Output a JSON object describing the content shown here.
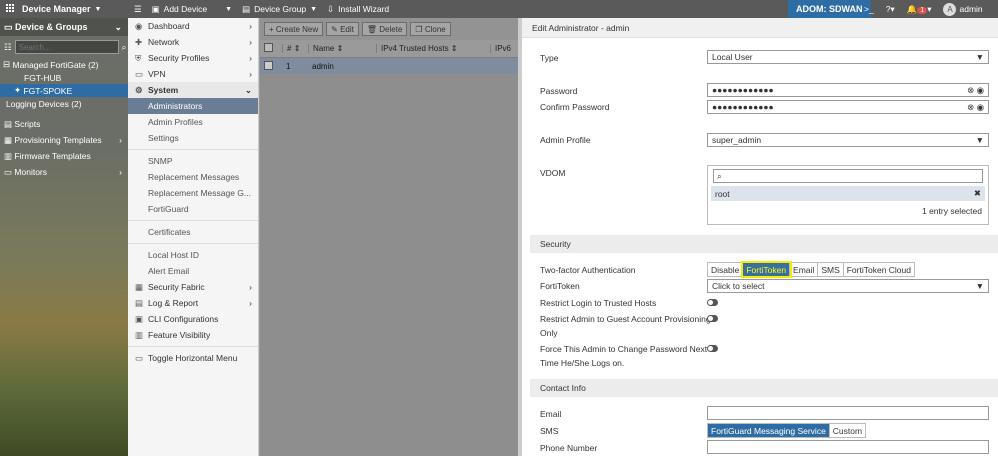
{
  "topbar": {
    "app": "Device Manager",
    "add_device": "Add Device",
    "device_group": "Device Group",
    "install_wizard": "Install Wizard",
    "adom": "ADOM: SDWAN",
    "notif_count": "1",
    "avatar": "A",
    "user": "admin"
  },
  "left": {
    "header": "Device & Groups",
    "search_placeholder": "Search...",
    "managed": "Managed FortiGate (2)",
    "hub": "FGT-HUB",
    "spoke": "FGT-SPOKE",
    "logging": "Logging Devices (2)",
    "nav": [
      "Scripts",
      "Provisioning Templates",
      "Firmware Templates",
      "Monitors"
    ]
  },
  "menu": {
    "items": [
      {
        "label": "Dashboard"
      },
      {
        "label": "Network"
      },
      {
        "label": "Security Profiles"
      },
      {
        "label": "VPN"
      }
    ],
    "system": "System",
    "sub": [
      "Administrators",
      "Admin Profiles",
      "Settings"
    ],
    "sub2": [
      "SNMP",
      "Replacement Messages",
      "Replacement Message G...",
      "FortiGuard"
    ],
    "sub3": [
      "Certificates"
    ],
    "sub4": [
      "Local Host ID",
      "Alert Email",
      "Security Fabric",
      "Log & Report",
      "CLI Configurations",
      "Feature Visibility"
    ],
    "sub5": [
      "Toggle Horizontal Menu"
    ]
  },
  "table": {
    "create_new": "Create New",
    "edit": "Edit",
    "delete": "Delete",
    "clone": "Clone",
    "col_num": "#",
    "col_name": "Name",
    "col_trusted": "IPv4 Trusted Hosts",
    "col_ipv6": "IPv6",
    "row_num": "1",
    "row_name": "admin"
  },
  "dialog": {
    "title": "Edit Administrator - admin",
    "type_label": "Type",
    "type_value": "Local User",
    "password_label": "Password",
    "password_value": "●●●●●●●●●●●●",
    "confirm_label": "Confirm Password",
    "confirm_value": "●●●●●●●●●●●●",
    "profile_label": "Admin Profile",
    "profile_value": "super_admin",
    "vdom_label": "VDOM",
    "vdom_item": "root",
    "vdom_count": "1 entry selected",
    "security": "Security",
    "twofactor_label": "Two-factor Authentication",
    "twofactor_options": [
      "Disable",
      "FortiToken",
      "Email",
      "SMS",
      "FortiToken Cloud"
    ],
    "fortitoken_label": "FortiToken",
    "fortitoken_value": "Click to select",
    "restrict_trusted": "Restrict Login to Trusted Hosts",
    "restrict_guest_1": "Restrict Admin to Guest Account Provisioning",
    "restrict_guest_2": "Only",
    "force_1": "Force This Admin to Change Password Next",
    "force_2": "Time He/She Logs on.",
    "contact": "Contact Info",
    "email_label": "Email",
    "sms_label": "SMS",
    "sms_options": [
      "FortiGuard Messaging Service",
      "Custom"
    ],
    "phone_label": "Phone Number"
  }
}
